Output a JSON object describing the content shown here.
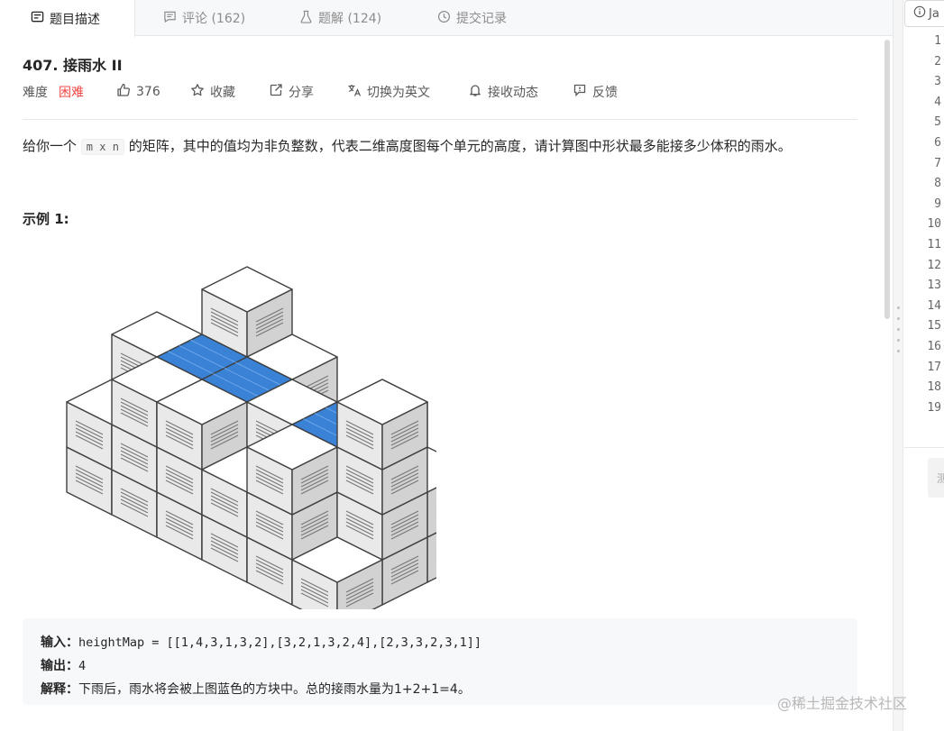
{
  "tabs": [
    {
      "label": "题目描述",
      "icon": "description-icon",
      "active": true
    },
    {
      "label": "评论 (162)",
      "icon": "comment-icon",
      "active": false
    },
    {
      "label": "题解 (124)",
      "icon": "flask-icon",
      "active": false
    },
    {
      "label": "提交记录",
      "icon": "history-icon",
      "active": false
    }
  ],
  "problem": {
    "title": "407. 接雨水 II",
    "difficulty_label": "难度",
    "difficulty": "困难",
    "difficulty_color": "#ef4743",
    "likes": "376",
    "favorite": "收藏",
    "share": "分享",
    "switch_lang": "切换为英文",
    "subscribe": "接收动态",
    "feedback": "反馈",
    "description_pre": "给你一个",
    "description_code": "m x n",
    "description_post": "的矩阵，其中的值均为非负整数，代表二维高度图每个单元的高度，请计算图中形状最多能接多少体积的雨水。",
    "example_title": "示例 1:"
  },
  "example": {
    "input_label": "输入：",
    "input_value": "heightMap = [[1,4,3,1,3,2],[3,2,1,3,2,4],[2,3,3,2,3,1]]",
    "output_label": "输出：",
    "output_value": "4",
    "explain_label": "解释：",
    "explain_value": "下雨后，雨水将会被上图蓝色的方块中。总的接雨水量为1+2+1=4。",
    "water_color": "#3a82d6"
  },
  "editor": {
    "language": "Ja",
    "line_numbers": [
      "1",
      "2",
      "3",
      "4",
      "5",
      "6",
      "7",
      "8",
      "9",
      "10",
      "11",
      "12",
      "13",
      "14",
      "15",
      "16",
      "17",
      "18",
      "19"
    ],
    "run_label": "测"
  },
  "watermark": "@稀土掘金技术社区"
}
